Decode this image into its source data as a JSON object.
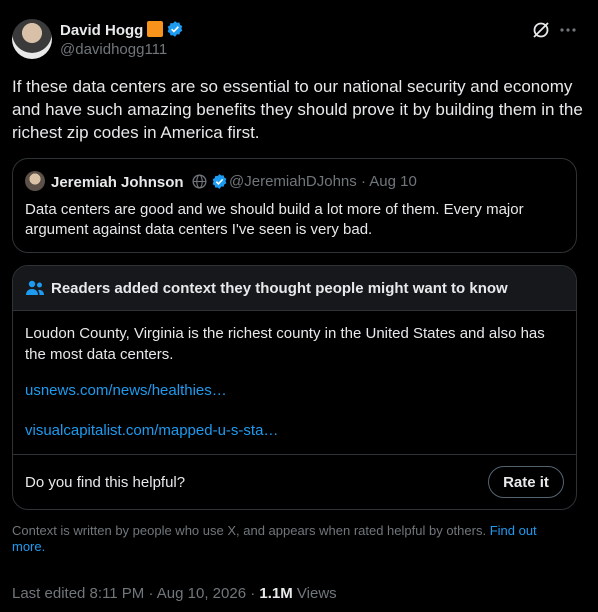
{
  "author": {
    "name": "David Hogg",
    "handle": "@davidhogg111"
  },
  "tweet": {
    "text": "If these data centers are so essential to our national security and economy and have such amazing benefits they should prove it by building them in the richest zip codes in America first."
  },
  "quote": {
    "name": "Jeremiah Johnson",
    "handle": "@JeremiahDJohns",
    "separator": "·",
    "date": "Aug 10",
    "text": "Data centers are good and we should build a lot more of them. Every major argument against data centers I've seen is very bad."
  },
  "community_note": {
    "title": "Readers added context they thought people might want to know",
    "body": "Loudon County, Virginia is the richest county in the United States and also has the most data centers.",
    "links": [
      "usnews.com/news/healthies…",
      "visualcapitalist.com/mapped-u-s-sta…"
    ],
    "helpful_prompt": "Do you find this helpful?",
    "rate_label": "Rate it"
  },
  "context_info": {
    "text": "Context is written by people who use X, and appears when rated helpful by others.",
    "link": "Find out more."
  },
  "footer": {
    "edited": "Last edited 8:11 PM · Aug 10, 2026 ·",
    "views_count": "1.1M",
    "views_label": "Views"
  },
  "colors": {
    "background": "#000000",
    "accent": "#1d9bf0",
    "badge": "#f7931a"
  }
}
